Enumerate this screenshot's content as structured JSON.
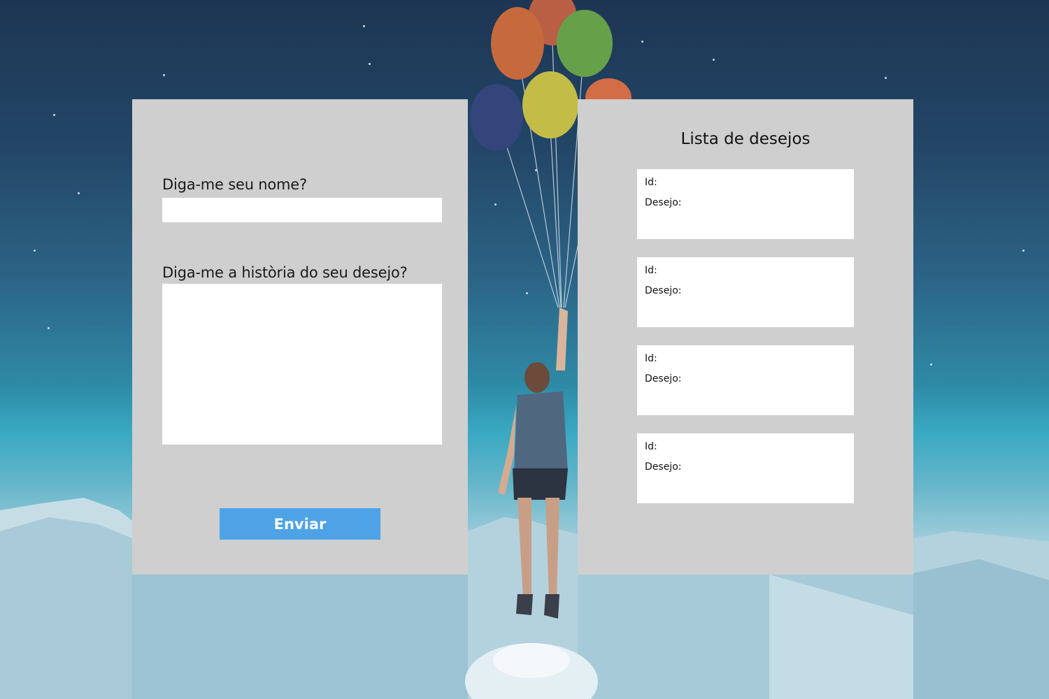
{
  "form": {
    "name_label": "Diga-me seu nome?",
    "name_value": "",
    "story_label": "Diga-me a història do seu desejo?",
    "story_value": "",
    "submit_label": "Enviar"
  },
  "wishlist": {
    "title": "Lista de desejos",
    "items": [
      {
        "id_label": "Id:",
        "wish_label": "Desejo:"
      },
      {
        "id_label": "Id:",
        "wish_label": "Desejo:"
      },
      {
        "id_label": "Id:",
        "wish_label": "Desejo:"
      },
      {
        "id_label": "Id:",
        "wish_label": "Desejo:"
      }
    ]
  },
  "colors": {
    "panel_bg": "#cfcfcf",
    "button_bg": "#4da3e6",
    "button_text": "#ffffff",
    "card_bg": "#ffffff"
  }
}
